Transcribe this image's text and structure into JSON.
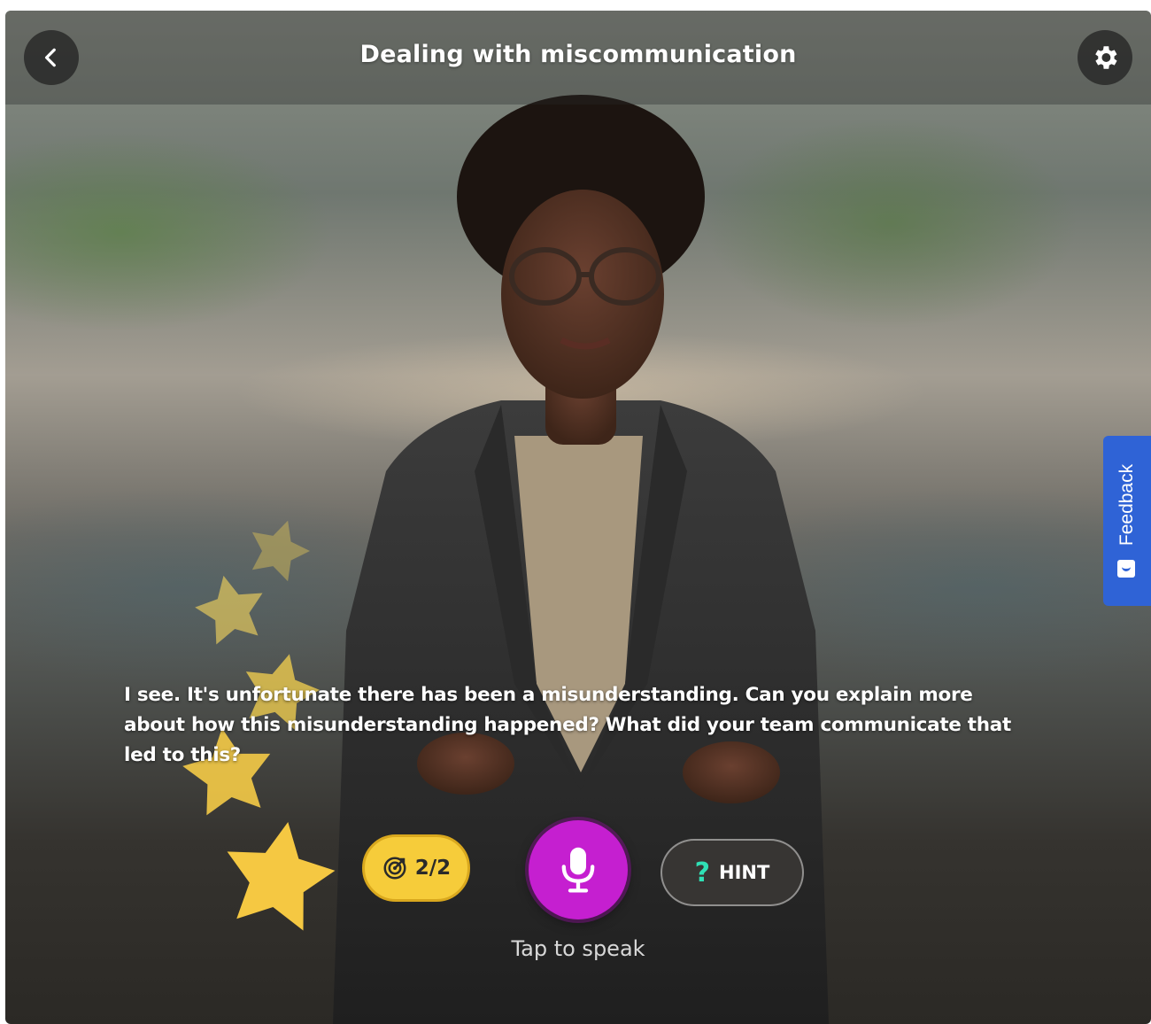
{
  "header": {
    "title": "Dealing with miscommunication",
    "back_icon": "chevron-left-icon",
    "settings_icon": "gear-icon"
  },
  "conversation": {
    "message": "I see. It's unfortunate there has been a misunderstanding. Can you explain more about how this misunderstanding happened? What did your team communicate that led to this?"
  },
  "controls": {
    "goal_progress": "2/2",
    "goal_icon": "target-icon",
    "mic_icon": "microphone-icon",
    "hint_icon": "?",
    "hint_label": "HINT",
    "speak_prompt": "Tap to speak"
  },
  "feedback_tab": {
    "label": "Feedback",
    "icon": "feedback-smile-icon"
  },
  "colors": {
    "mic_button": "#c51fd0",
    "goal_badge": "#f6cc3a",
    "hint_icon": "#2fe0b5",
    "feedback_tab": "#2f63d6",
    "star": "#f5c842"
  }
}
